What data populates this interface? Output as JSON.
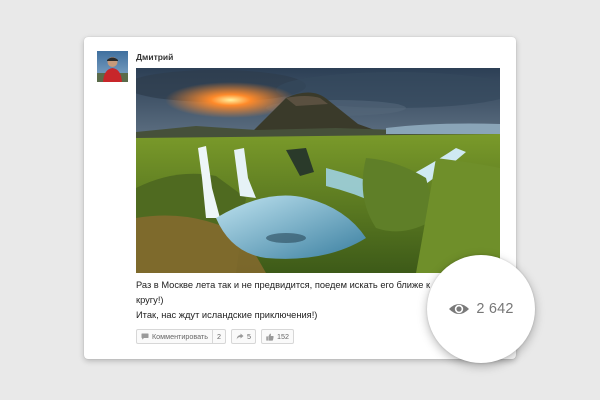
{
  "post": {
    "author": "Дмитрий",
    "text_line1": "Раз в Москве лета так и не предвидится, поедем искать его ближе к",
    "text_line2": "кругу!)",
    "text_line3": "Итак, нас ждут исландские приключения!)"
  },
  "actions": {
    "comment_label": "Комментировать",
    "comment_count": "2",
    "share_count": "5",
    "like_count": "152"
  },
  "views": {
    "count": "2 642"
  },
  "icons": {
    "comment": "speech-bubble-icon",
    "share": "share-arrow-icon",
    "like": "thumbs-up-icon",
    "views": "eye-icon"
  },
  "colors": {
    "background": "#e9e9e9",
    "card": "#ffffff",
    "muted_text": "#777777"
  }
}
